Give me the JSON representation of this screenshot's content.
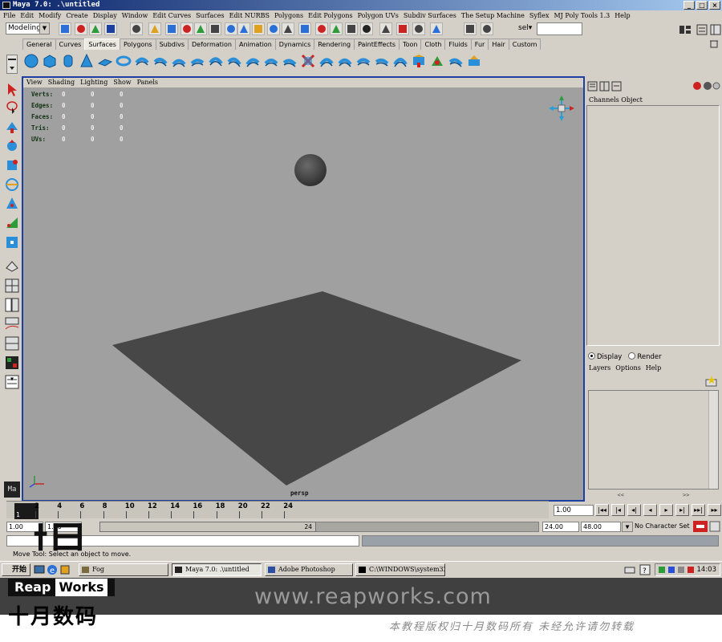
{
  "window": {
    "title": "Maya 7.0: .\\untitled",
    "controls": [
      "_",
      "□",
      "×"
    ]
  },
  "menubar": [
    "File",
    "Edit",
    "Modify",
    "Create",
    "Display",
    "Window",
    "Edit Curves",
    "Surfaces",
    "Edit NURBS",
    "Polygons",
    "Edit Polygons",
    "Polygon UVs",
    "Subdiv Surfaces",
    "The Setup Machine",
    "Syflex",
    "MJ Poly Tools 1.3",
    "Help"
  ],
  "statusline": {
    "mode": "Modeling",
    "sel_label": "sel▾",
    "sel_value": ""
  },
  "shelf": {
    "tabs": [
      "General",
      "Curves",
      "Surfaces",
      "Polygons",
      "Subdivs",
      "Deformation",
      "Animation",
      "Dynamics",
      "Rendering",
      "PaintEffects",
      "Toon",
      "Cloth",
      "Fluids",
      "Fur",
      "Hair",
      "Custom"
    ],
    "active_tab": "Surfaces",
    "icons": [
      "sphere-icon",
      "cube-icon",
      "cylinder-icon",
      "cone-icon",
      "plane-icon",
      "torus-icon",
      "revolve-icon",
      "loft-icon",
      "planar-icon",
      "extrude-icon",
      "birail-icon",
      "boundary-icon",
      "square-icon",
      "bevel-icon",
      "trim-icon",
      "untrim-icon",
      "intersect-icon",
      "project-curve-icon",
      "fillet-icon",
      "attach-icon",
      "detach-icon",
      "rebuild-icon",
      "sculpt-icon",
      "insert-isoparm-icon",
      "offset-icon"
    ]
  },
  "viewport": {
    "menu": [
      "View",
      "Shading",
      "Lighting",
      "Show",
      "Panels"
    ],
    "hud": [
      {
        "label": "Verts:",
        "values": [
          "0",
          "0",
          "0"
        ]
      },
      {
        "label": "Edges:",
        "values": [
          "0",
          "0",
          "0"
        ]
      },
      {
        "label": "Faces:",
        "values": [
          "0",
          "0",
          "0"
        ]
      },
      {
        "label": "Tris:",
        "values": [
          "0",
          "0",
          "0"
        ]
      },
      {
        "label": "UVs:",
        "values": [
          "0",
          "0",
          "0"
        ]
      }
    ],
    "camera": "persp",
    "bg_color": "#a0a0a0",
    "plane_color": "#474747",
    "sphere_color": "#4a4a4a"
  },
  "channelbox": {
    "tabs": [
      "Channels",
      "Object"
    ]
  },
  "layers": {
    "display_label": "Display",
    "render_label": "Render",
    "menu": [
      "Layers",
      "Options",
      "Help"
    ]
  },
  "timeslider": {
    "ticks": [
      "2",
      "4",
      "6",
      "8",
      "10",
      "12",
      "14",
      "16",
      "18",
      "20",
      "22",
      "24"
    ],
    "current_frame": "1",
    "current_time_field": "1.00"
  },
  "range": {
    "start": "1.00",
    "start2": "1.00",
    "end_inner": "24",
    "end": "24.00",
    "end2": "48.00",
    "character_set": "No Character Set"
  },
  "helpline": "Move Tool: Select an object to move.",
  "playback": [
    "|◂◂",
    "|◂",
    "◂|",
    "◂",
    "▸",
    "▸|",
    "▸▸|",
    "▸▸"
  ],
  "taskbar": {
    "start": "开始",
    "tasks": [
      "Fog",
      "Maya 7.0: .\\untitled",
      "Adobe Photoshop",
      "C:\\WINDOWS\\system32..."
    ],
    "clock": "14:03"
  },
  "watermark": {
    "url": "www.reapworks.com",
    "note": "本教程版权归十月数码所有 未经允许请勿转载",
    "logo_en_1": "Reap",
    "logo_en_2": "Works",
    "logo_cn": "十月数码"
  }
}
